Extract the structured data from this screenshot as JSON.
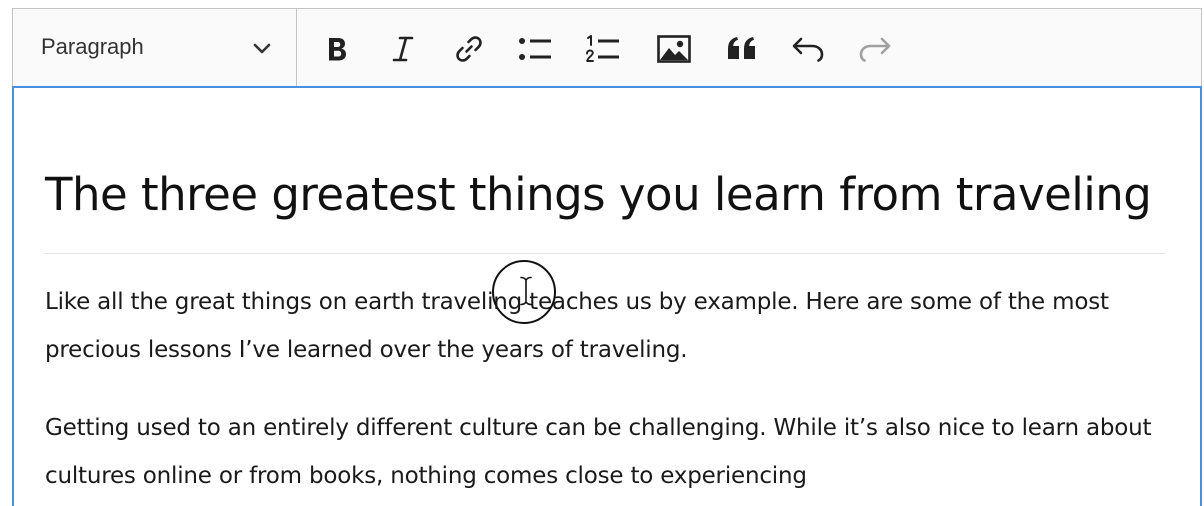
{
  "toolbar": {
    "heading_dropdown": {
      "selected": "Paragraph"
    },
    "buttons": [
      {
        "name": "bold",
        "icon": "bold-icon"
      },
      {
        "name": "italic",
        "icon": "italic-icon"
      },
      {
        "name": "link",
        "icon": "link-icon"
      },
      {
        "name": "bulleted-list",
        "icon": "bulleted-list-icon"
      },
      {
        "name": "numbered-list",
        "icon": "numbered-list-icon"
      },
      {
        "name": "insert-image",
        "icon": "image-icon"
      },
      {
        "name": "block-quote",
        "icon": "quote-icon"
      },
      {
        "name": "undo",
        "icon": "undo-icon"
      },
      {
        "name": "redo",
        "icon": "redo-icon",
        "disabled": true
      }
    ]
  },
  "document": {
    "title": "The three greatest things you learn from traveling",
    "paragraphs": [
      "Like all the great things on earth traveling teaches us by example. Here are some of the most precious lessons I’ve learned over the years of traveling.",
      "Getting used to an entirely different culture can be challenging. While it’s also nice to learn about cultures online or from books, nothing comes close to experiencing"
    ]
  },
  "colors": {
    "focus_border": "#4a90e2",
    "toolbar_background": "#fafafa",
    "disabled_icon": "#a0a0a0"
  }
}
